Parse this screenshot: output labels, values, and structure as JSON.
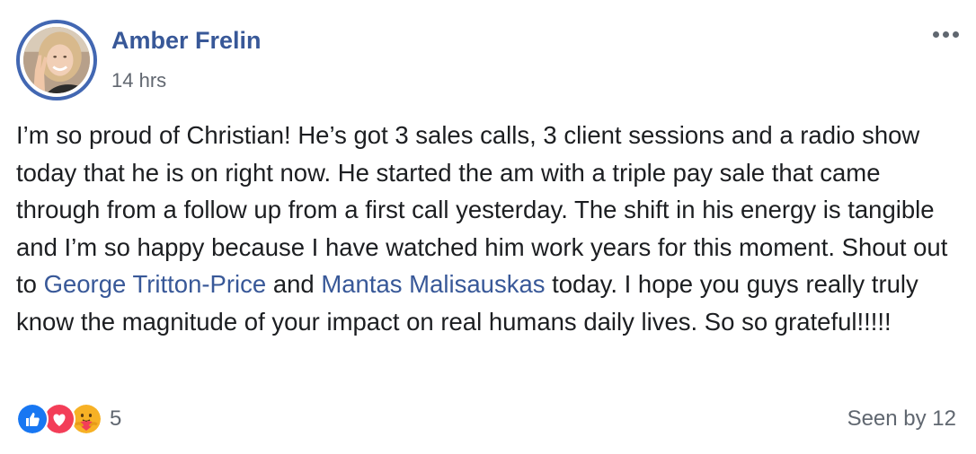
{
  "author": {
    "name": "Amber Frelin",
    "timestamp": "14 hrs"
  },
  "post": {
    "text_before_mention1": "I’m so proud of Christian! He’s got 3 sales calls, 3 client sessions and a radio show today that he is on right now. He started the am with a triple pay sale that came through from a follow up from a first call yesterday. The shift in his energy is tangible and I’m so happy because I have watched him work years for this moment. Shout out to ",
    "mention1": "George Tritton-Price",
    "text_between": " and ",
    "mention2": "Mantas Malisauskas",
    "text_after": " today. I hope you guys really truly know the magnitude of your impact on real humans daily lives. So so grateful!!!!!"
  },
  "reactions": {
    "icons": [
      "like-icon",
      "love-icon",
      "care-icon"
    ],
    "count": "5"
  },
  "seen_by": "Seen by 12",
  "colors": {
    "link": "#385898",
    "avatar_ring": "#4267b2",
    "like": "#1877f2",
    "love": "#f33e58",
    "care": "#f7b125",
    "meta_text": "#606770"
  }
}
